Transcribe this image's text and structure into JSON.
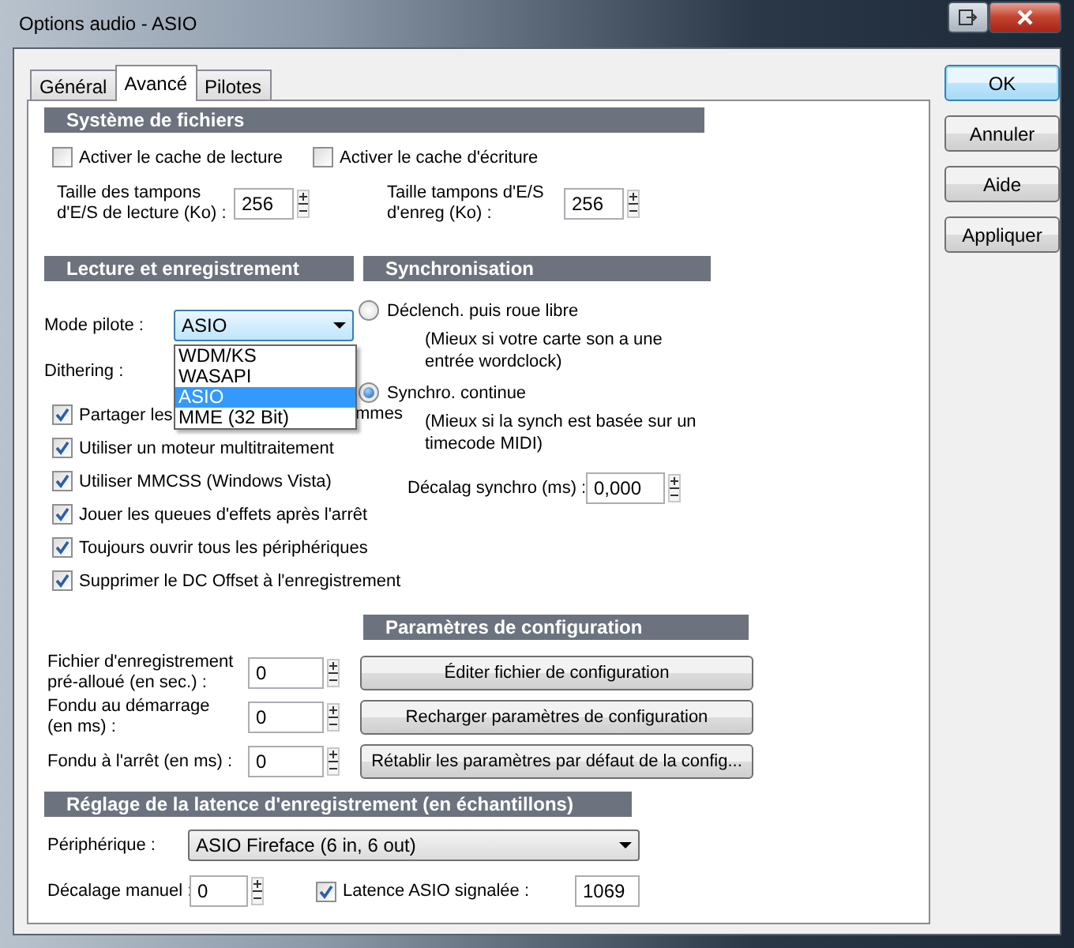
{
  "window": {
    "title": "Options audio - ASIO"
  },
  "tabs": [
    {
      "label": "Général",
      "selected": false
    },
    {
      "label": "Avancé",
      "selected": true
    },
    {
      "label": "Pilotes",
      "selected": false
    }
  ],
  "buttons": [
    {
      "label": "OK",
      "default": true
    },
    {
      "label": "Annuler",
      "default": false
    },
    {
      "label": "Aide",
      "default": false
    },
    {
      "label": "Appliquer",
      "default": false
    }
  ],
  "file_system": {
    "header": "Système de fichiers",
    "checkboxes": [
      {
        "label": "Activer le cache de lecture",
        "checked": false
      },
      {
        "label": "Activer le cache d'écriture",
        "checked": false
      }
    ],
    "buffers": [
      {
        "label": "Taille des tampons\nd'E/S de lecture (Ko) :",
        "value": "256"
      },
      {
        "label": "Taille tampons d'E/S\nd'enreg (Ko) :",
        "value": "256"
      }
    ]
  },
  "playback": {
    "header": "Lecture et enregistrement",
    "driver_mode": {
      "label": "Mode pilote :",
      "value": "ASIO",
      "expanded": true,
      "options": [
        {
          "label": "WDM/KS",
          "selected": false
        },
        {
          "label": "WASAPI",
          "selected": false
        },
        {
          "label": "ASIO",
          "selected": true
        },
        {
          "label": "MME (32 Bit)",
          "selected": false
        }
      ]
    },
    "dithering": {
      "label": "Dithering :"
    },
    "checkboxes": [
      {
        "label": "Partager les",
        "label_end": "mmes",
        "checked": true
      },
      {
        "label": "Utiliser un moteur multitraitement",
        "checked": true
      },
      {
        "label": "Utiliser MMCSS (Windows Vista)",
        "checked": true
      },
      {
        "label": "Jouer les queues d'effets après l'arrêt",
        "checked": true
      },
      {
        "label": "Toujours ouvrir tous les périphériques",
        "checked": true
      },
      {
        "label": "Supprimer le DC Offset à l'enregistrement",
        "checked": true
      }
    ]
  },
  "sync": {
    "header": "Synchronisation",
    "options": [
      {
        "label": "Déclench. puis roue libre",
        "description": "(Mieux si votre carte son a une entrée wordclock)",
        "selected": false
      },
      {
        "label": "Synchro. continue",
        "description": "(Mieux si la synch est basée sur un timecode MIDI)",
        "selected": true
      }
    ],
    "offset": {
      "label": "Décalag synchro (ms) :",
      "value": "0,000"
    }
  },
  "config": {
    "header": "Paramètres de configuration",
    "fields": [
      {
        "label": "Fichier d'enregistrement\npré-alloué (en sec.) :",
        "value": "0"
      },
      {
        "label": "Fondu au démarrage\n(en ms) :",
        "value": "0"
      },
      {
        "label": "Fondu à l'arrêt  (en ms) :",
        "value": "0"
      }
    ],
    "buttons": [
      "Éditer fichier de configuration",
      "Recharger paramètres de configuration",
      "Rétablir les paramètres par défaut de la config..."
    ]
  },
  "latency": {
    "header": "Réglage de la latence d'enregistrement (en échantillons)",
    "device": {
      "label": "Périphérique :",
      "value": "ASIO Fireface (6 in, 6 out)"
    },
    "manual_offset": {
      "label": "Décalage manuel :",
      "value": "0"
    },
    "reported": {
      "label": "Latence ASIO signalée :",
      "checked": true,
      "value": "1069"
    }
  }
}
